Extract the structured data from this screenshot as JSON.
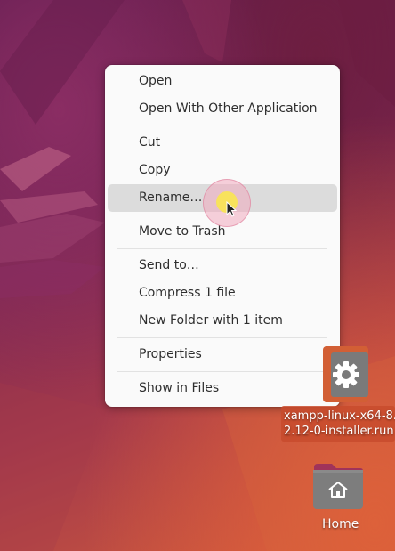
{
  "context_menu": {
    "groups": [
      [
        {
          "label": "Open"
        },
        {
          "label": "Open With Other Application"
        }
      ],
      [
        {
          "label": "Cut"
        },
        {
          "label": "Copy"
        },
        {
          "label": "Rename…",
          "highlighted": true
        }
      ],
      [
        {
          "label": "Move to Trash"
        }
      ],
      [
        {
          "label": "Send to…"
        },
        {
          "label": "Compress 1 file"
        },
        {
          "label": "New Folder with 1 item"
        }
      ],
      [
        {
          "label": "Properties"
        }
      ],
      [
        {
          "label": "Show in Files"
        }
      ]
    ]
  },
  "desktop": {
    "icons": [
      {
        "name": "xampp-linux-x64-8.2.12-0-installer.run",
        "label_line1": "xampp-linux-x64-8.",
        "label_line2": "2.12-0-installer.run",
        "icon": "gear-icon",
        "selected": true
      },
      {
        "name": "Home",
        "label": "Home",
        "icon": "home-folder-icon"
      }
    ]
  },
  "colors": {
    "menu_bg": "#fafafa",
    "menu_highlight": "#dcdcdc",
    "selection": "#d25f35",
    "wallpaper_dark": "#5a1a4e",
    "wallpaper_light": "#cf5a3c"
  }
}
